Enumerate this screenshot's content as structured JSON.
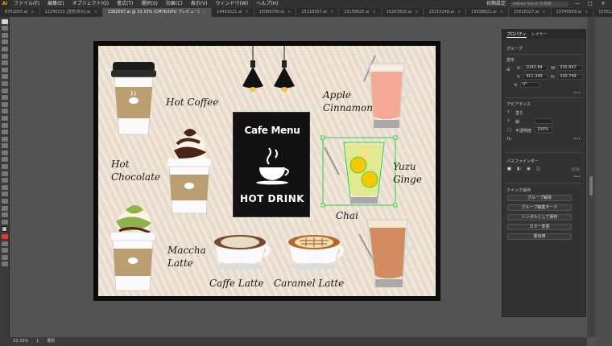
{
  "app": {
    "logo": "Ai",
    "menus": [
      "ファイル(F)",
      "編集(E)",
      "オブジェクト(O)",
      "書式(T)",
      "選択(S)",
      "効果(C)",
      "表示(V)",
      "ウィンドウ(W)",
      "ヘルプ(H)"
    ],
    "workspace": "初期設定",
    "search_placeholder": "Adobe Stock を検索",
    "window_controls": [
      "—",
      "□",
      "✕"
    ]
  },
  "tabs": [
    {
      "label": "8761855.ai",
      "active": false
    },
    {
      "label": "12245315 [変形済み].ai",
      "active": false
    },
    {
      "label": "1382097.ai @ 33.33% (CMYK/GPU プレビュー)",
      "active": true
    },
    {
      "label": "14491621.ai",
      "active": false
    },
    {
      "label": "15086795.ai",
      "active": false
    },
    {
      "label": "15118557.ai",
      "active": false
    },
    {
      "label": "15158625.ai",
      "active": false
    },
    {
      "label": "15263915.ai",
      "active": false
    },
    {
      "label": "15315148.ai",
      "active": false
    },
    {
      "label": "15538621.ai",
      "active": false
    },
    {
      "label": "15616327.ai",
      "active": false
    },
    {
      "label": "15745839.ai",
      "active": false
    },
    {
      "label": "15951210.ai",
      "active": false
    },
    {
      "label": "16489298.ai",
      "active": false
    },
    {
      "label": "16599715.ai",
      "active": false
    },
    {
      "label": "16619708",
      "active": false
    }
  ],
  "artwork": {
    "sign_title": "Cafe Menu",
    "sign_subtitle": "HOT DRINK",
    "items": {
      "hot_coffee": "Hot Coffee",
      "hot_chocolate_1": "Hot",
      "hot_chocolate_2": "Chocolate",
      "maccha_1": "Maccha",
      "maccha_2": "Latte",
      "caffe_latte": "Caffe Latte",
      "caramel_latte": "Caramel Latte",
      "apple_1": "Apple",
      "apple_2": "Cinnamon",
      "yuzu_1": "Yuzu",
      "yuzu_2": "Ginge",
      "chai": "Chai"
    },
    "cup_brand": "COFFEE"
  },
  "panel": {
    "tabs": [
      "プロパティ",
      "レイヤー"
    ],
    "active_tab": "プロパティ",
    "group_label": "グループ",
    "transform_label": "変形",
    "x": "1042.84",
    "y": "411.349",
    "w": "330.847",
    "h": "330.749",
    "angle": "0°",
    "appearance_label": "アピアランス",
    "fill_label": "塗り",
    "stroke_label": "線",
    "opacity_label": "不透明度",
    "opacity": "100%",
    "fx_label": "fx",
    "pathfinder_label": "パスファインダー",
    "expand_label": "拡張",
    "quick_actions_label": "クイック操作",
    "buttons": [
      "グループ解除",
      "グループ編集モード",
      "シンボルとして保存",
      "カラー変更",
      "書出用"
    ]
  },
  "status": {
    "zoom": "33.33%",
    "page": "1",
    "tool": "選択"
  },
  "colors": {
    "accent_selection": "#2ecc40",
    "cup_sleeve": "#bb9e6f",
    "chai_tea": "#c8703a",
    "apple_drink": "#ef8d73",
    "yuzu_drink": "#d9e36a",
    "chocolate": "#4a2418",
    "maccha": "#8fb24a"
  }
}
